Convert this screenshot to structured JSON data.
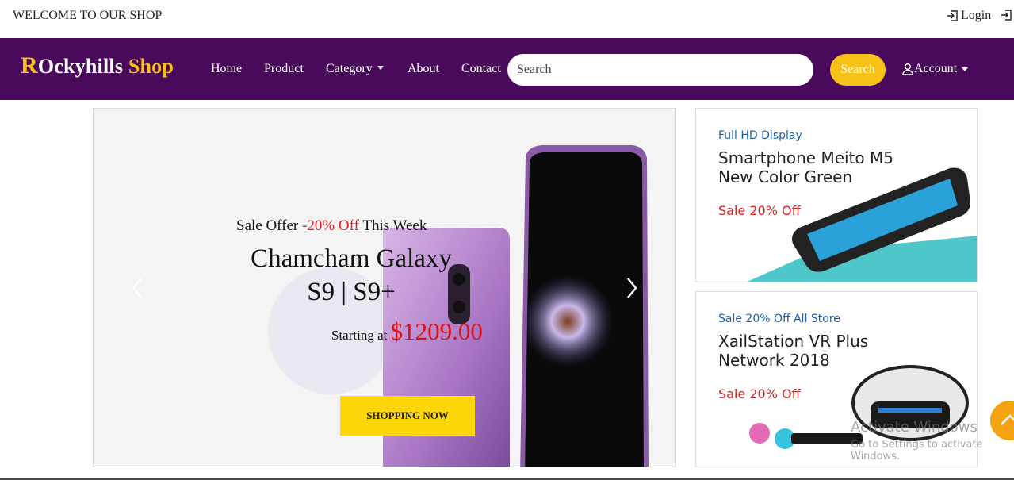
{
  "topbar": {
    "welcome": "WELCOME TO OUR SHOP",
    "login_label": "Login"
  },
  "brand": {
    "initial": "R",
    "rest": "Ockyhills",
    "shop": "Shop"
  },
  "nav": {
    "home": "Home",
    "product": "Product",
    "category": "Category",
    "about": "About",
    "contact": "Contact"
  },
  "search": {
    "placeholder": "Search",
    "button": "Search"
  },
  "account": {
    "label": "Account"
  },
  "slide": {
    "offer_prefix": "Sale Offer",
    "offer_discount": "-20% Off",
    "offer_suffix": "This Week",
    "title": "Chamcham Galaxy S9 | S9+",
    "price_prefix": "Starting at",
    "price": "$1209.00",
    "cta": "SHOPPING NOW"
  },
  "banners": [
    {
      "kicker": "Full HD Display",
      "line1": "Smartphone Meito M5",
      "line2": "New Color Green",
      "sale": "Sale 20% Off"
    },
    {
      "kicker": "Sale 20% Off All Store",
      "line1": "XailStation VR Plus",
      "line2": "Network 2018",
      "sale": "Sale 20% Off"
    }
  ],
  "watermark": {
    "line1": "Activate Windows",
    "line2": "Go to Settings to activate Windows."
  },
  "colors": {
    "navbar": "#4a0a5c",
    "accent": "#f8c116",
    "sale_red": "#e02020"
  }
}
